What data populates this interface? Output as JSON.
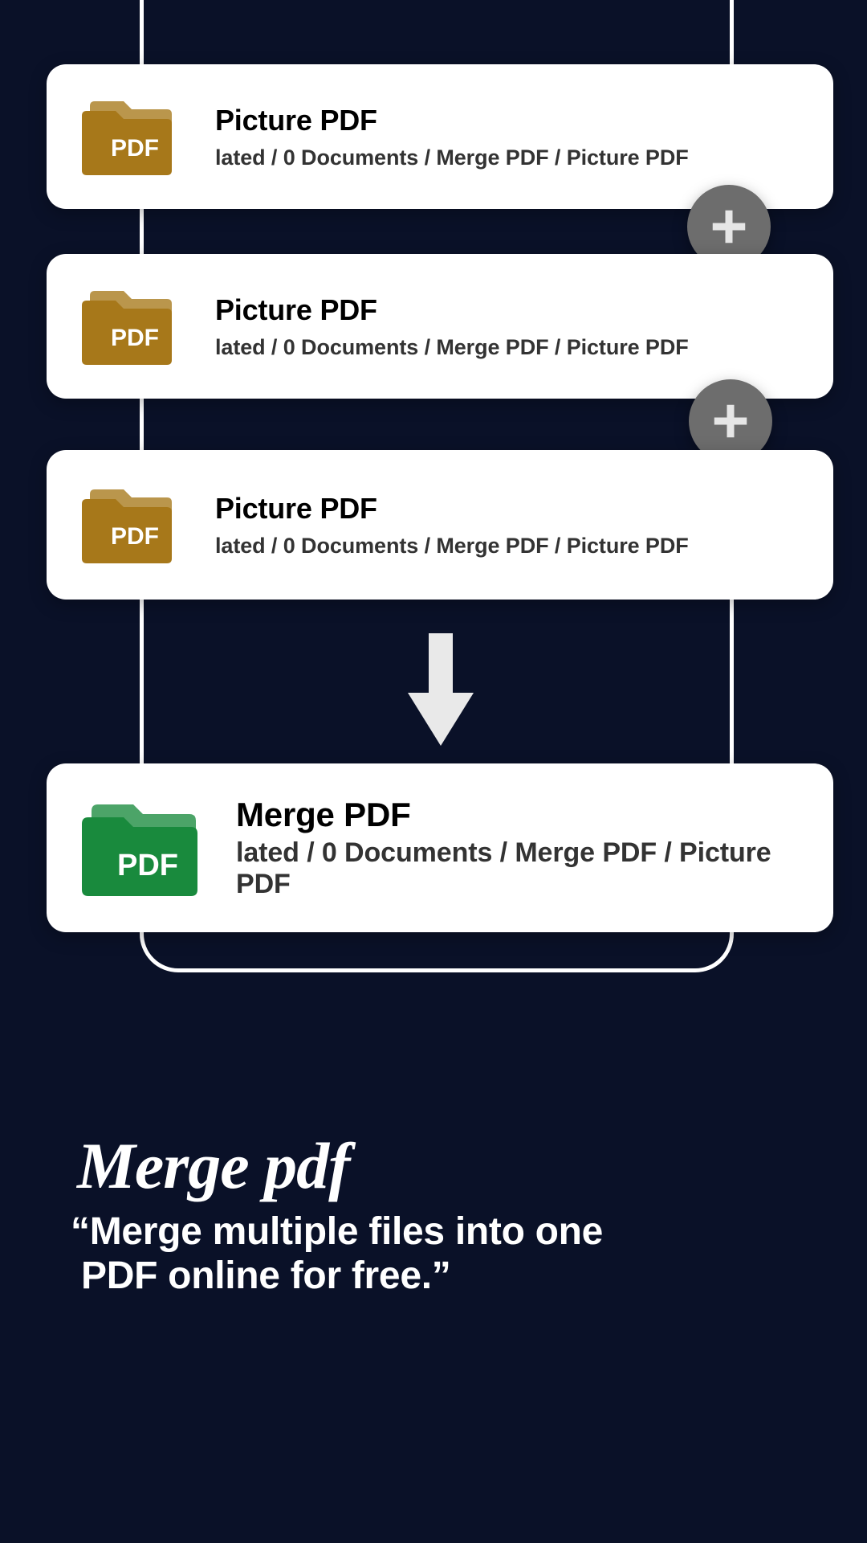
{
  "source_cards": [
    {
      "title": "Picture PDF",
      "subtitle": "lated / 0 Documents / Merge PDF / Picture PDF",
      "icon_label": "PDF"
    },
    {
      "title": "Picture PDF",
      "subtitle": "lated / 0 Documents / Merge PDF / Picture PDF",
      "icon_label": "PDF"
    },
    {
      "title": "Picture PDF",
      "subtitle": "lated / 0 Documents / Merge PDF / Picture PDF",
      "icon_label": "PDF"
    }
  ],
  "result_card": {
    "title": "Merge PDF",
    "subtitle": "lated / 0 Documents / Merge PDF / Picture PDF",
    "icon_label": "PDF"
  },
  "headline": "Merge pdf",
  "subheadline": "“Merge multiple files into one\n PDF online for free.”",
  "colors": {
    "source_folder": "#a7781a",
    "result_folder": "#198a3d",
    "plus_bg": "#6d6d6d",
    "bg": "#0a1128"
  }
}
